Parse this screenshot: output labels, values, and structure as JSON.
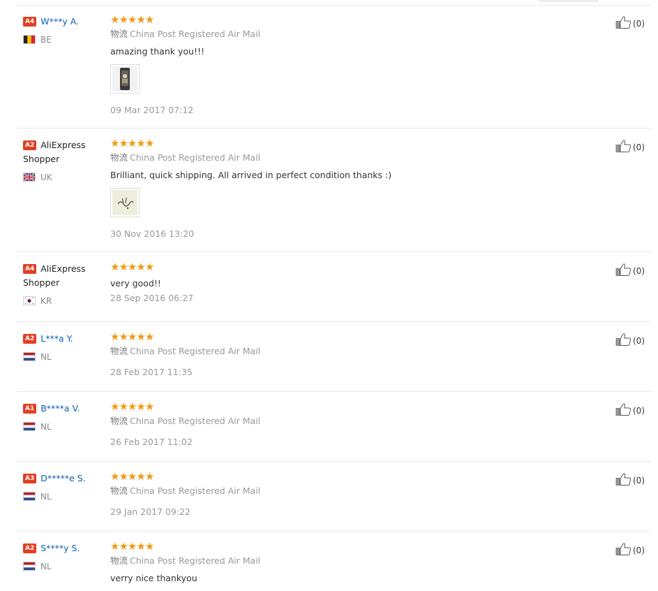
{
  "reviews": [
    {
      "badge": "A4",
      "name": "W***y A.",
      "name_style": "link",
      "country": "BE",
      "flag": "be",
      "rating": 5,
      "shipping_label": "物流",
      "shipping": "China Post Registered Air Mail",
      "comment": "amazing thank you!!!",
      "has_photo": true,
      "photo_icon": "phone-photo",
      "date": "09 Mar 2017 07:12",
      "helpful": "(0)"
    },
    {
      "badge": "A2",
      "name": "AliExpress Shopper",
      "name_style": "plain",
      "country": "UK",
      "flag": "uk",
      "rating": 5,
      "shipping_label": "物流",
      "shipping": "China Post Registered Air Mail",
      "comment": "Brilliant, quick shipping. All arrived in perfect condition thanks :)",
      "has_photo": true,
      "photo_icon": "thank-you-note-photo",
      "date": "30 Nov 2016 13:20",
      "helpful": "(0)"
    },
    {
      "badge": "A4",
      "name": "AliExpress Shopper",
      "name_style": "plain",
      "country": "KR",
      "flag": "kr",
      "rating": 5,
      "shipping_label": "",
      "shipping": "",
      "comment": "very good!!",
      "has_photo": false,
      "date": "28 Sep 2016 06:27",
      "helpful": "(0)"
    },
    {
      "badge": "A2",
      "name": "L***a Y.",
      "name_style": "link",
      "country": "NL",
      "flag": "nl",
      "rating": 5,
      "shipping_label": "物流",
      "shipping": "China Post Registered Air Mail",
      "comment": "",
      "has_photo": false,
      "date": "28 Feb 2017 11:35",
      "helpful": "(0)"
    },
    {
      "badge": "A1",
      "name": "B****a V.",
      "name_style": "link",
      "country": "NL",
      "flag": "nl",
      "rating": 5,
      "shipping_label": "物流",
      "shipping": "China Post Registered Air Mail",
      "comment": "",
      "has_photo": false,
      "date": "26 Feb 2017 11:02",
      "helpful": "(0)"
    },
    {
      "badge": "A3",
      "name": "D*****e S.",
      "name_style": "link",
      "country": "NL",
      "flag": "nl",
      "rating": 5,
      "shipping_label": "物流",
      "shipping": "China Post Registered Air Mail",
      "comment": "",
      "has_photo": false,
      "date": "29 Jan 2017 09:22",
      "helpful": "(0)"
    },
    {
      "badge": "A2",
      "name": "S****y S.",
      "name_style": "link",
      "country": "NL",
      "flag": "nl",
      "rating": 5,
      "shipping_label": "物流",
      "shipping": "China Post Registered Air Mail",
      "comment": "verry nice thankyou",
      "has_photo": false,
      "date": "",
      "helpful": "(0)"
    }
  ],
  "colors": {
    "badge": "#e23f21",
    "star": "#f09a12",
    "link": "#0b60b0",
    "muted": "#999999"
  }
}
